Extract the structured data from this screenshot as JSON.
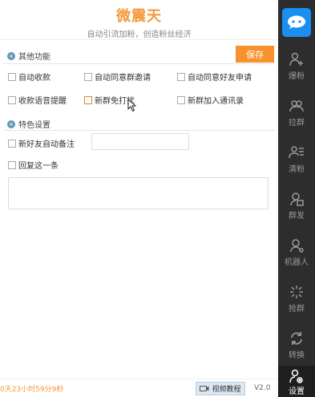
{
  "header": {
    "title": "微震天",
    "subtitle": "自动引流加粉，创造粉丝经济"
  },
  "sections": {
    "other": {
      "title": "其他功能"
    },
    "special": {
      "title": "特色设置"
    }
  },
  "save_label": "保存",
  "options": {
    "auto_collect": "自动收款",
    "auto_accept_group": "自动同意群邀请",
    "auto_accept_friend": "自动同意好友申请",
    "voice_reminder": "收款语音提醒",
    "new_group_dnd": "新群免打扰",
    "new_group_contacts": "新群加入通讯录",
    "auto_remark": "新好友自动备注",
    "reply_this": "回复这一条"
  },
  "remark_value": "",
  "reply_value": "",
  "footer": {
    "timer": "0天23小时59分9秒",
    "video_label": "视频教程",
    "version": "V2.0"
  },
  "nav": [
    {
      "label": "爆粉",
      "icon": "add-user-icon"
    },
    {
      "label": "拉群",
      "icon": "group-icon"
    },
    {
      "label": "清粉",
      "icon": "user-list-icon"
    },
    {
      "label": "群发",
      "icon": "broadcast-icon"
    },
    {
      "label": "机器人",
      "icon": "robot-icon"
    },
    {
      "label": "抢群",
      "icon": "grab-icon"
    },
    {
      "label": "转换",
      "icon": "convert-icon"
    },
    {
      "label": "设置",
      "icon": "settings-icon"
    }
  ],
  "colors": {
    "accent": "#f39a3c",
    "save_button": "#f7922f",
    "sidebar": "#2d2d2d",
    "logo": "#1a8fef"
  }
}
